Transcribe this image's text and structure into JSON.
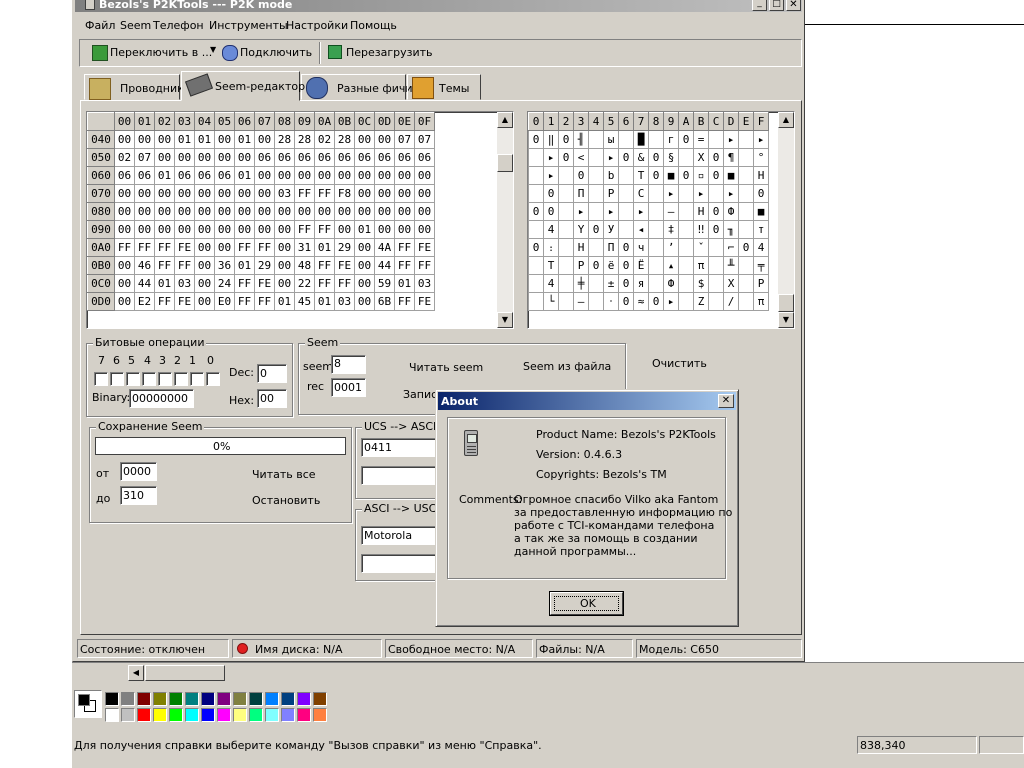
{
  "window": {
    "title": "Bezols's P2KTools --- P2K mode"
  },
  "menu": [
    "Файл",
    "Seem",
    "Телефон",
    "Инструменты",
    "Настройки",
    "Помощь"
  ],
  "toolbar": {
    "switch": "Переключить в ...",
    "connect": "Подключить",
    "reboot": "Перезагрузить"
  },
  "tabs": [
    "Проводник",
    "Seem-редактор",
    "Разные фичи",
    "Темы"
  ],
  "hex": {
    "headers": [
      "00",
      "01",
      "02",
      "03",
      "04",
      "05",
      "06",
      "07",
      "08",
      "09",
      "0A",
      "0B",
      "0C",
      "0D",
      "0E",
      "0F"
    ],
    "rows": [
      {
        "addr": "040",
        "cells": [
          "00",
          "00",
          "00",
          "01",
          "01",
          "00",
          "01",
          "00",
          "28",
          "28",
          "02",
          "28",
          "00",
          "00",
          "07",
          "07"
        ]
      },
      {
        "addr": "050",
        "cells": [
          "02",
          "07",
          "00",
          "00",
          "00",
          "00",
          "00",
          "06",
          "06",
          "06",
          "06",
          "06",
          "06",
          "06",
          "06",
          "06"
        ]
      },
      {
        "addr": "060",
        "cells": [
          "06",
          "06",
          "01",
          "06",
          "06",
          "06",
          "01",
          "00",
          "00",
          "00",
          "00",
          "00",
          "00",
          "00",
          "00",
          "00"
        ]
      },
      {
        "addr": "070",
        "cells": [
          "00",
          "00",
          "00",
          "00",
          "00",
          "00",
          "00",
          "00",
          "03",
          "FF",
          "FF",
          "F8",
          "00",
          "00",
          "00",
          "00"
        ]
      },
      {
        "addr": "080",
        "cells": [
          "00",
          "00",
          "00",
          "00",
          "00",
          "00",
          "00",
          "00",
          "00",
          "00",
          "00",
          "00",
          "00",
          "00",
          "00",
          "00"
        ]
      },
      {
        "addr": "090",
        "cells": [
          "00",
          "00",
          "00",
          "00",
          "00",
          "00",
          "00",
          "00",
          "00",
          "FF",
          "FF",
          "00",
          "01",
          "00",
          "00",
          "00"
        ]
      },
      {
        "addr": "0A0",
        "cells": [
          "FF",
          "FF",
          "FF",
          "FE",
          "00",
          "00",
          "FF",
          "FF",
          "00",
          "31",
          "01",
          "29",
          "00",
          "4A",
          "FF",
          "FE"
        ]
      },
      {
        "addr": "0B0",
        "cells": [
          "00",
          "46",
          "FF",
          "FF",
          "00",
          "36",
          "01",
          "29",
          "00",
          "48",
          "FF",
          "FE",
          "00",
          "44",
          "FF",
          "FF"
        ]
      },
      {
        "addr": "0C0",
        "cells": [
          "00",
          "44",
          "01",
          "03",
          "00",
          "24",
          "FF",
          "FE",
          "00",
          "22",
          "FF",
          "FF",
          "00",
          "59",
          "01",
          "03"
        ]
      },
      {
        "addr": "0D0",
        "cells": [
          "00",
          "E2",
          "FF",
          "FE",
          "00",
          "E0",
          "FF",
          "FF",
          "01",
          "45",
          "01",
          "03",
          "00",
          "6B",
          "FF",
          "FE"
        ]
      }
    ]
  },
  "ascii": {
    "headers": [
      "0",
      "1",
      "2",
      "3",
      "4",
      "5",
      "6",
      "7",
      "8",
      "9",
      "A",
      "B",
      "C",
      "D",
      "E",
      "F"
    ],
    "rows": [
      [
        "0",
        "‖",
        "0",
        "╢",
        "",
        "ы",
        "",
        "█",
        "",
        "г",
        "0",
        "=",
        "",
        "▸",
        "",
        "▸"
      ],
      [
        "",
        "▸",
        "0",
        "<",
        "",
        "▸",
        "0",
        "&",
        "0",
        "§",
        "",
        "Х",
        "0",
        "¶",
        "",
        "°"
      ],
      [
        "",
        "▸",
        "",
        "0",
        "",
        "b",
        "",
        "T",
        "0",
        "■",
        "0",
        "▫",
        "0",
        "■",
        "",
        "H"
      ],
      [
        "",
        "0",
        "",
        "П",
        "",
        "P",
        "",
        "C",
        "",
        "▸",
        "",
        "▸",
        "",
        "▸",
        "",
        "0"
      ],
      [
        "0",
        "0",
        "",
        "▸",
        "",
        "▸",
        "",
        "▸",
        "",
        "–",
        "",
        "Н",
        "0",
        "Ф",
        "",
        "■"
      ],
      [
        "",
        "4",
        "",
        "Y",
        "0",
        "У",
        "",
        "◂",
        "",
        "‡",
        "",
        "‼",
        "0",
        "╖",
        "",
        "т"
      ],
      [
        "0",
        "։",
        "",
        "Н",
        "",
        "П",
        "0",
        "ч",
        "",
        "ʼ",
        "",
        "ˇ",
        "",
        "⌐",
        "0",
        "4"
      ],
      [
        "",
        "T",
        "",
        "Р",
        "0",
        "ë",
        "0",
        "Ё",
        "",
        "▴",
        "",
        "π",
        "",
        "╨",
        "",
        "╤"
      ],
      [
        "",
        "4",
        "",
        "╪",
        "",
        "±",
        "0",
        "я",
        "",
        "Ф",
        "",
        "$",
        "",
        "Х",
        "",
        "Р"
      ],
      [
        "",
        "└",
        "",
        "–",
        "",
        "‧",
        "0",
        "≈",
        "0",
        "▸",
        "",
        "Z",
        "",
        "/",
        "",
        "π"
      ]
    ]
  },
  "bits": {
    "title": "Битовые операции",
    "digits": [
      "7",
      "6",
      "5",
      "4",
      "3",
      "2",
      "1",
      "0"
    ],
    "dec_label": "Dec:",
    "dec_value": "0",
    "binary_label": "Binary:",
    "binary_value": "00000000",
    "hex_label": "Hex:",
    "hex_value": "00"
  },
  "seem": {
    "title": "Seem",
    "seem_label": "seem",
    "seem_value": "8",
    "rec_label": "rec",
    "rec_value": "0001",
    "read": "Читать seem",
    "from_file": "Seem из файла",
    "write": "Записать",
    "clear": "Очистить"
  },
  "save": {
    "title": "Сохранение Seem",
    "progress_text": "0%",
    "progress_value": 0,
    "from_label": "от",
    "from_value": "0000",
    "to_label": "до",
    "to_value": "310",
    "read_all": "Читать все",
    "stop": "Остановить"
  },
  "ucs": {
    "title": "UCS --> ASCI",
    "value": "0411"
  },
  "asci": {
    "title": "ASCI --> USC",
    "value": "Motorola"
  },
  "status": {
    "state": "Состояние: отключен",
    "disk": "Имя диска: N/A",
    "free": "Свободное место: N/A",
    "files": "Файлы: N/A",
    "model": "Модель: C650"
  },
  "about": {
    "title": "About",
    "product": "Product Name: Bezols's P2KTools",
    "version": "Version: 0.4.6.3",
    "copyright": "Copyrights: Bezols's TM",
    "comments_label": "Comments:",
    "comments": [
      "Огромное спасибо Vilko aka Fantom",
      "за предоставленную информацию по",
      "работе с TCI-командами телефона",
      "а так же за помощь в создании",
      "данной программы..."
    ],
    "ok": "OK"
  },
  "paint": {
    "colors_top": [
      "#000000",
      "#808080",
      "#800000",
      "#808000",
      "#008000",
      "#008080",
      "#000080",
      "#800080",
      "#808040",
      "#004040",
      "#0080ff",
      "#004080",
      "#8000ff",
      "#804000"
    ],
    "colors_bottom": [
      "#ffffff",
      "#c0c0c0",
      "#ff0000",
      "#ffff00",
      "#00ff00",
      "#00ffff",
      "#0000ff",
      "#ff00ff",
      "#ffff80",
      "#00ff80",
      "#80ffff",
      "#8080ff",
      "#ff0080",
      "#ff8040"
    ],
    "status_help": "Для получения справки выберите команду \"Вызов справки\" из меню \"Справка\".",
    "coords": "838,340"
  }
}
